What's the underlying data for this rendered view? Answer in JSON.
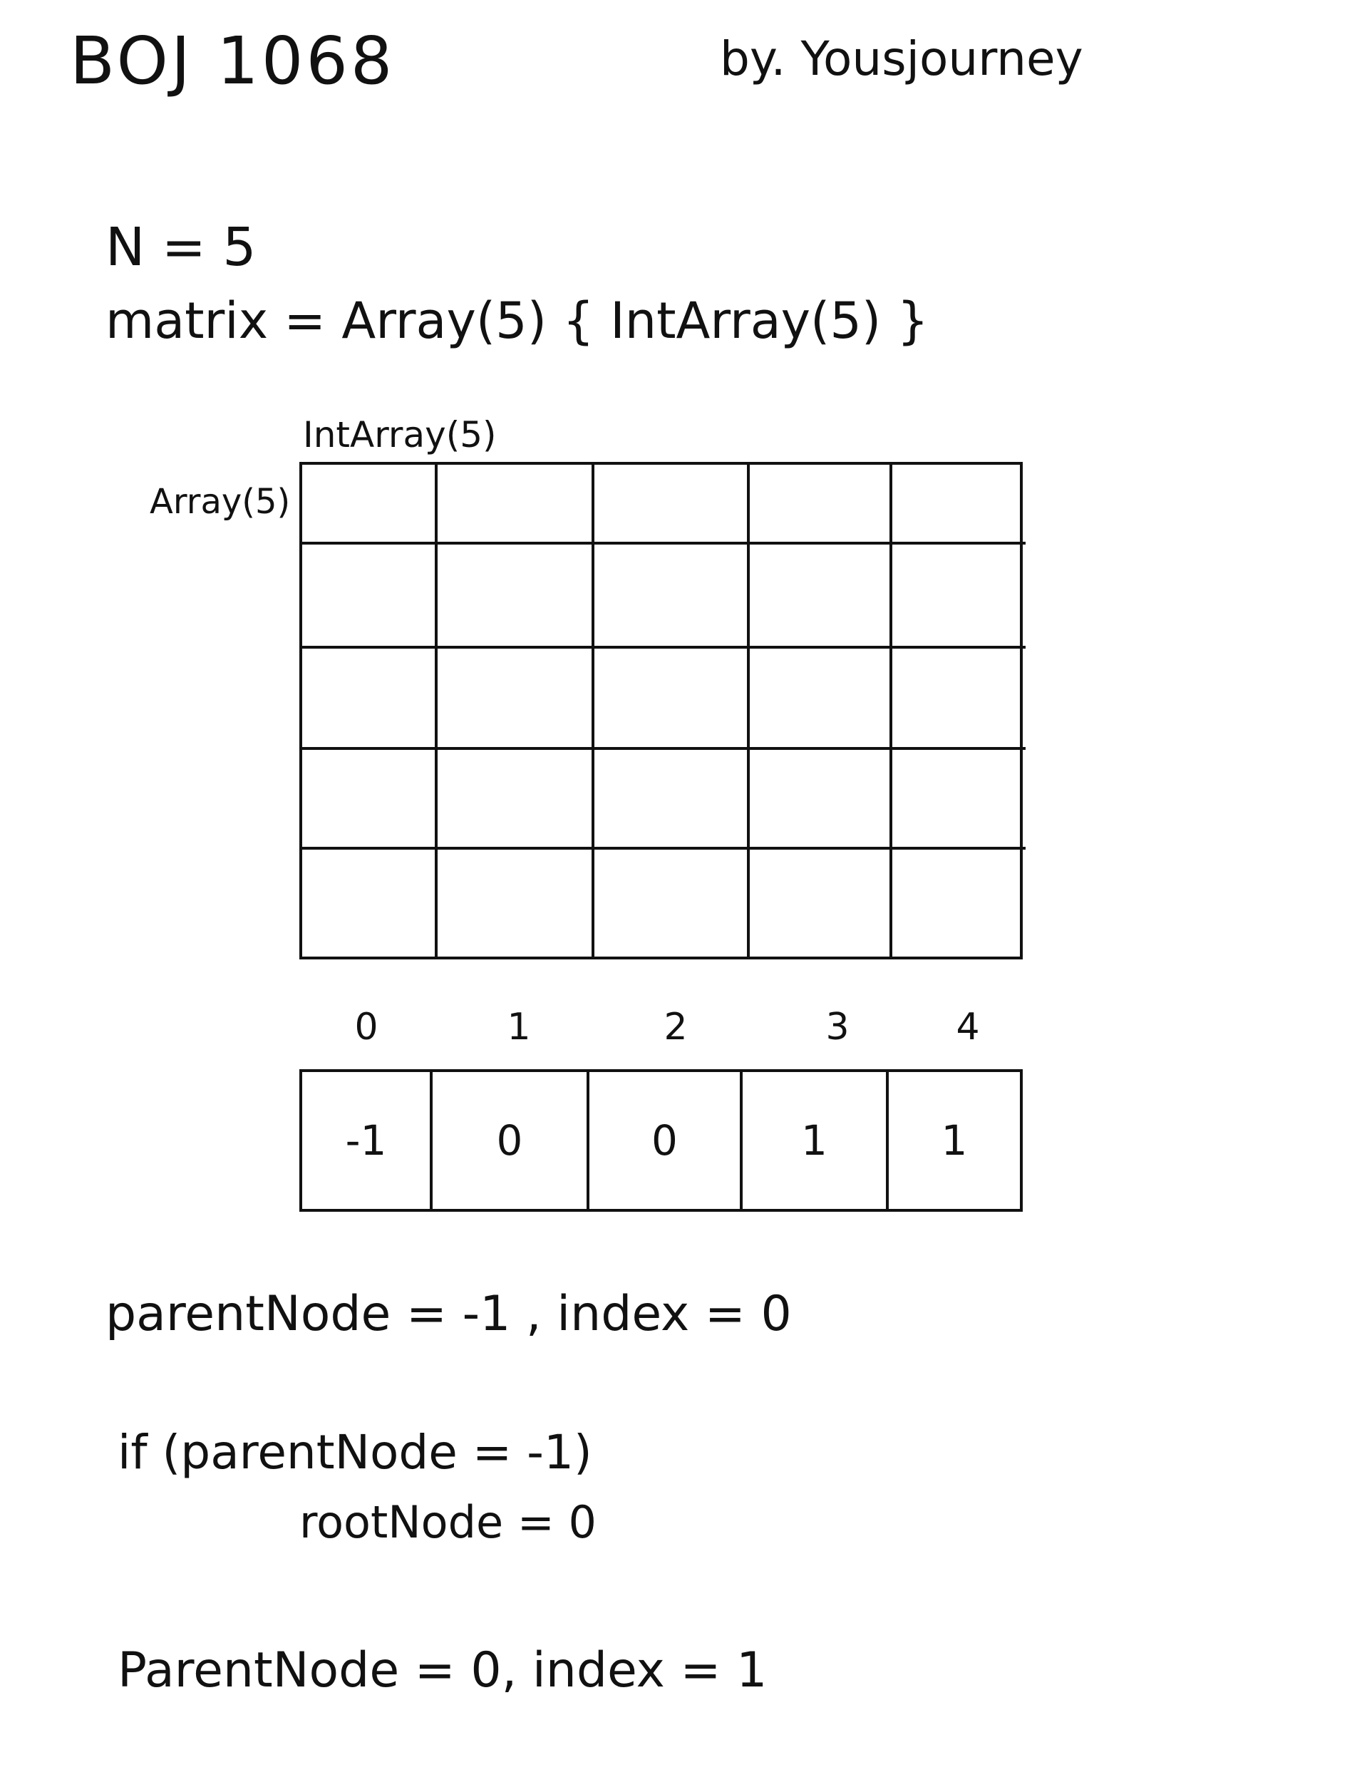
{
  "header": {
    "title": "BOJ 1068",
    "author": "by. Yousjourney"
  },
  "setup": {
    "n_line": "N = 5",
    "matrix_line": "matrix = Array(5) { IntArray(5) }",
    "inner_label": "IntArray(5)",
    "outer_label": "Array(5)"
  },
  "parent_array": {
    "indices": [
      "0",
      "1",
      "2",
      "3",
      "4"
    ],
    "values": [
      "-1",
      "0",
      "0",
      "1",
      "1"
    ]
  },
  "walkthrough": {
    "step1": "parentNode = -1 , index = 0",
    "step2_condition": "if (parentNode = -1)",
    "step2_body": "rootNode = 0",
    "step3": "ParentNode = 0, index = 1"
  }
}
